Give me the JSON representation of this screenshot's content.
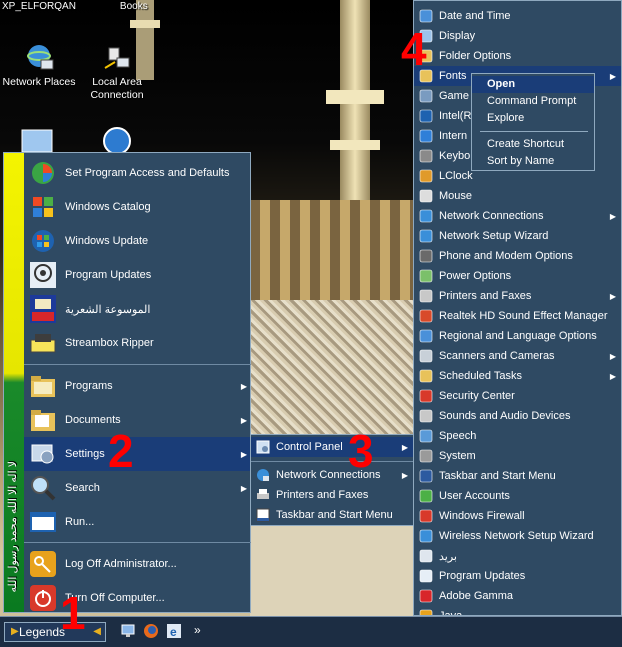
{
  "desktop": {
    "top_labels": [
      "XP_ELFORQAN",
      "Books"
    ],
    "icons": [
      {
        "label": "Network Places"
      },
      {
        "label": "Local Area Connection"
      }
    ]
  },
  "start_menu": {
    "sidebar_text": "لا اله الا الله محمد رسول الله",
    "pinned": [
      {
        "label": "Set Program Access and Defaults",
        "icon": "program-access-icon"
      },
      {
        "label": "Windows Catalog",
        "icon": "windows-catalog-icon"
      },
      {
        "label": "Windows Update",
        "icon": "windows-update-icon"
      },
      {
        "label": "Program Updates",
        "icon": "program-updates-icon"
      },
      {
        "label": "الموسوعة الشعرية",
        "icon": "poetry-encyclopedia-icon"
      },
      {
        "label": "Streambox Ripper",
        "icon": "streambox-icon"
      }
    ],
    "main": [
      {
        "label": "Programs",
        "icon": "programs-folder-icon",
        "arrow": true
      },
      {
        "label": "Documents",
        "icon": "documents-folder-icon",
        "arrow": true
      },
      {
        "label": "Settings",
        "icon": "settings-icon",
        "arrow": true,
        "highlighted": true
      },
      {
        "label": "Search",
        "icon": "search-icon",
        "arrow": true
      },
      {
        "label": "Run...",
        "icon": "run-icon",
        "arrow": false
      }
    ],
    "bottom": [
      {
        "label": "Log Off Administrator...",
        "icon": "key-icon"
      },
      {
        "label": "Turn Off Computer...",
        "icon": "power-icon"
      }
    ]
  },
  "settings_menu": {
    "items": [
      {
        "label": "Control Panel",
        "icon": "control-panel-icon",
        "arrow": true,
        "highlighted": true
      },
      {
        "label": "Network Connections",
        "icon": "network-connections-icon",
        "arrow": true
      },
      {
        "label": "Printers and Faxes",
        "icon": "printer-icon",
        "arrow": false
      },
      {
        "label": "Taskbar and Start Menu",
        "icon": "taskbar-icon",
        "arrow": false
      }
    ]
  },
  "control_panel_menu": {
    "items": [
      {
        "label": "Date and Time",
        "arrow": false
      },
      {
        "label": "Display",
        "arrow": false
      },
      {
        "label": "Folder Options",
        "arrow": false
      },
      {
        "label": "Fonts",
        "arrow": true,
        "highlighted": true
      },
      {
        "label": "Game",
        "arrow": false
      },
      {
        "label": "Intel(R",
        "arrow": false
      },
      {
        "label": "Intern",
        "arrow": false
      },
      {
        "label": "Keybo",
        "arrow": false
      },
      {
        "label": "LClock",
        "arrow": false
      },
      {
        "label": "Mouse",
        "arrow": false
      },
      {
        "label": "Network Connections",
        "arrow": true
      },
      {
        "label": "Network Setup Wizard",
        "arrow": false
      },
      {
        "label": "Phone and Modem Options",
        "arrow": false
      },
      {
        "label": "Power Options",
        "arrow": false
      },
      {
        "label": "Printers and Faxes",
        "arrow": true
      },
      {
        "label": "Realtek HD Sound Effect Manager",
        "arrow": false
      },
      {
        "label": "Regional and Language Options",
        "arrow": false
      },
      {
        "label": "Scanners and Cameras",
        "arrow": true
      },
      {
        "label": "Scheduled Tasks",
        "arrow": true
      },
      {
        "label": "Security Center",
        "arrow": false
      },
      {
        "label": "Sounds and Audio Devices",
        "arrow": false
      },
      {
        "label": "Speech",
        "arrow": false
      },
      {
        "label": "System",
        "arrow": false
      },
      {
        "label": "Taskbar and Start Menu",
        "arrow": false
      },
      {
        "label": "User Accounts",
        "arrow": false
      },
      {
        "label": "Windows Firewall",
        "arrow": false
      },
      {
        "label": "Wireless Network Setup Wizard",
        "arrow": false
      },
      {
        "label": "بريد",
        "arrow": false
      },
      {
        "label": "Program Updates",
        "arrow": false
      },
      {
        "label": "Adobe Gamma",
        "arrow": false
      },
      {
        "label": "Java",
        "arrow": false
      }
    ]
  },
  "context_menu": {
    "items": [
      "Open",
      "Command Prompt",
      "Explore",
      "Create Shortcut",
      "Sort by Name"
    ]
  },
  "annotations": [
    "1",
    "2",
    "3",
    "4"
  ],
  "taskbar": {
    "start_label": "Legends",
    "chevron": "»"
  },
  "colors": {
    "menu_bg": "#2f4a63",
    "highlight": "#1a3d78",
    "annotation": "#ff0000"
  }
}
